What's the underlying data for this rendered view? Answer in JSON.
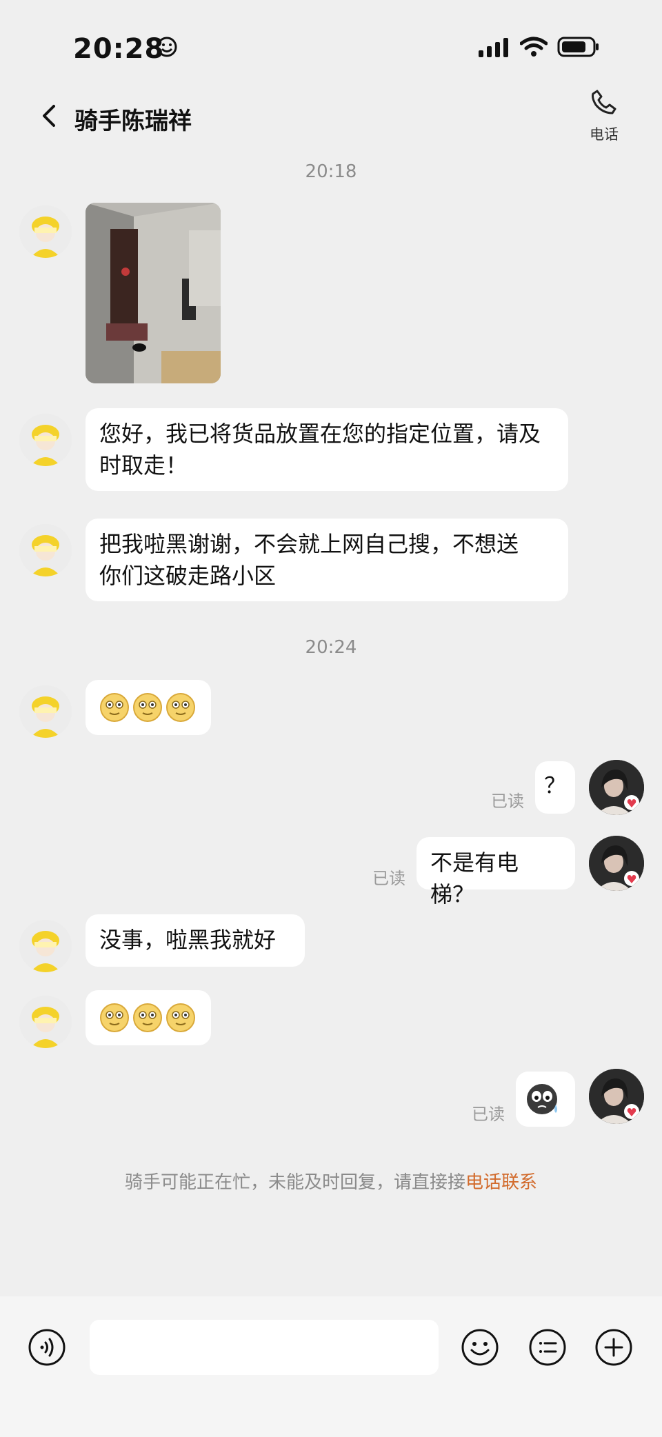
{
  "status_bar": {
    "time": "20:28"
  },
  "header": {
    "title": "骑手陈瑞祥",
    "call_label": "电话"
  },
  "timestamps": [
    "20:18",
    "20:24"
  ],
  "messages": {
    "m2": "您好，我已将货品放置在您的指定位置，请及时取走！",
    "m3_line1": "把我啦黑谢谢，不会就上网自己搜，不想送",
    "m3_line2": "你们这破走路小区",
    "me1": "？",
    "me2": "不是有电梯？",
    "m6": "没事，啦黑我就好",
    "read_label": "已读"
  },
  "notice": {
    "text": "骑手可能正在忙，未能及时回复，请直接接",
    "link": "电话联系"
  },
  "colors": {
    "background": "#efefef",
    "bubble": "#ffffff",
    "link": "#d26a2b",
    "rider_helmet": "#f4d22a"
  }
}
